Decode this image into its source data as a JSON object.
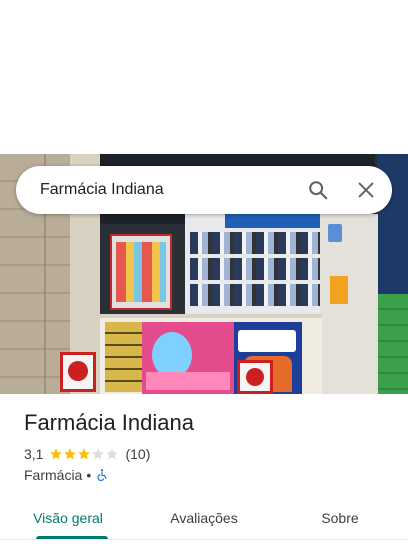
{
  "search": {
    "query": "Farmácia Indiana",
    "search_icon": "search-icon",
    "close_icon": "close-icon"
  },
  "photo": {
    "icon": "storefront-photo"
  },
  "place": {
    "name": "Farmácia Indiana",
    "rating": "3,1",
    "rating_stars": 3.1,
    "review_count": "(10)",
    "category": "Farmácia",
    "separator": "•",
    "accessibility_icon": "wheelchair-icon"
  },
  "tabs": [
    {
      "label": "Visão geral",
      "active": true
    },
    {
      "label": "Avaliações",
      "active": false
    },
    {
      "label": "Sobre",
      "active": false
    }
  ],
  "colors": {
    "star_filled": "#fbbc04",
    "star_empty": "#dadce0",
    "accent": "#00796b",
    "accessibility_blue": "#1a73e8"
  }
}
